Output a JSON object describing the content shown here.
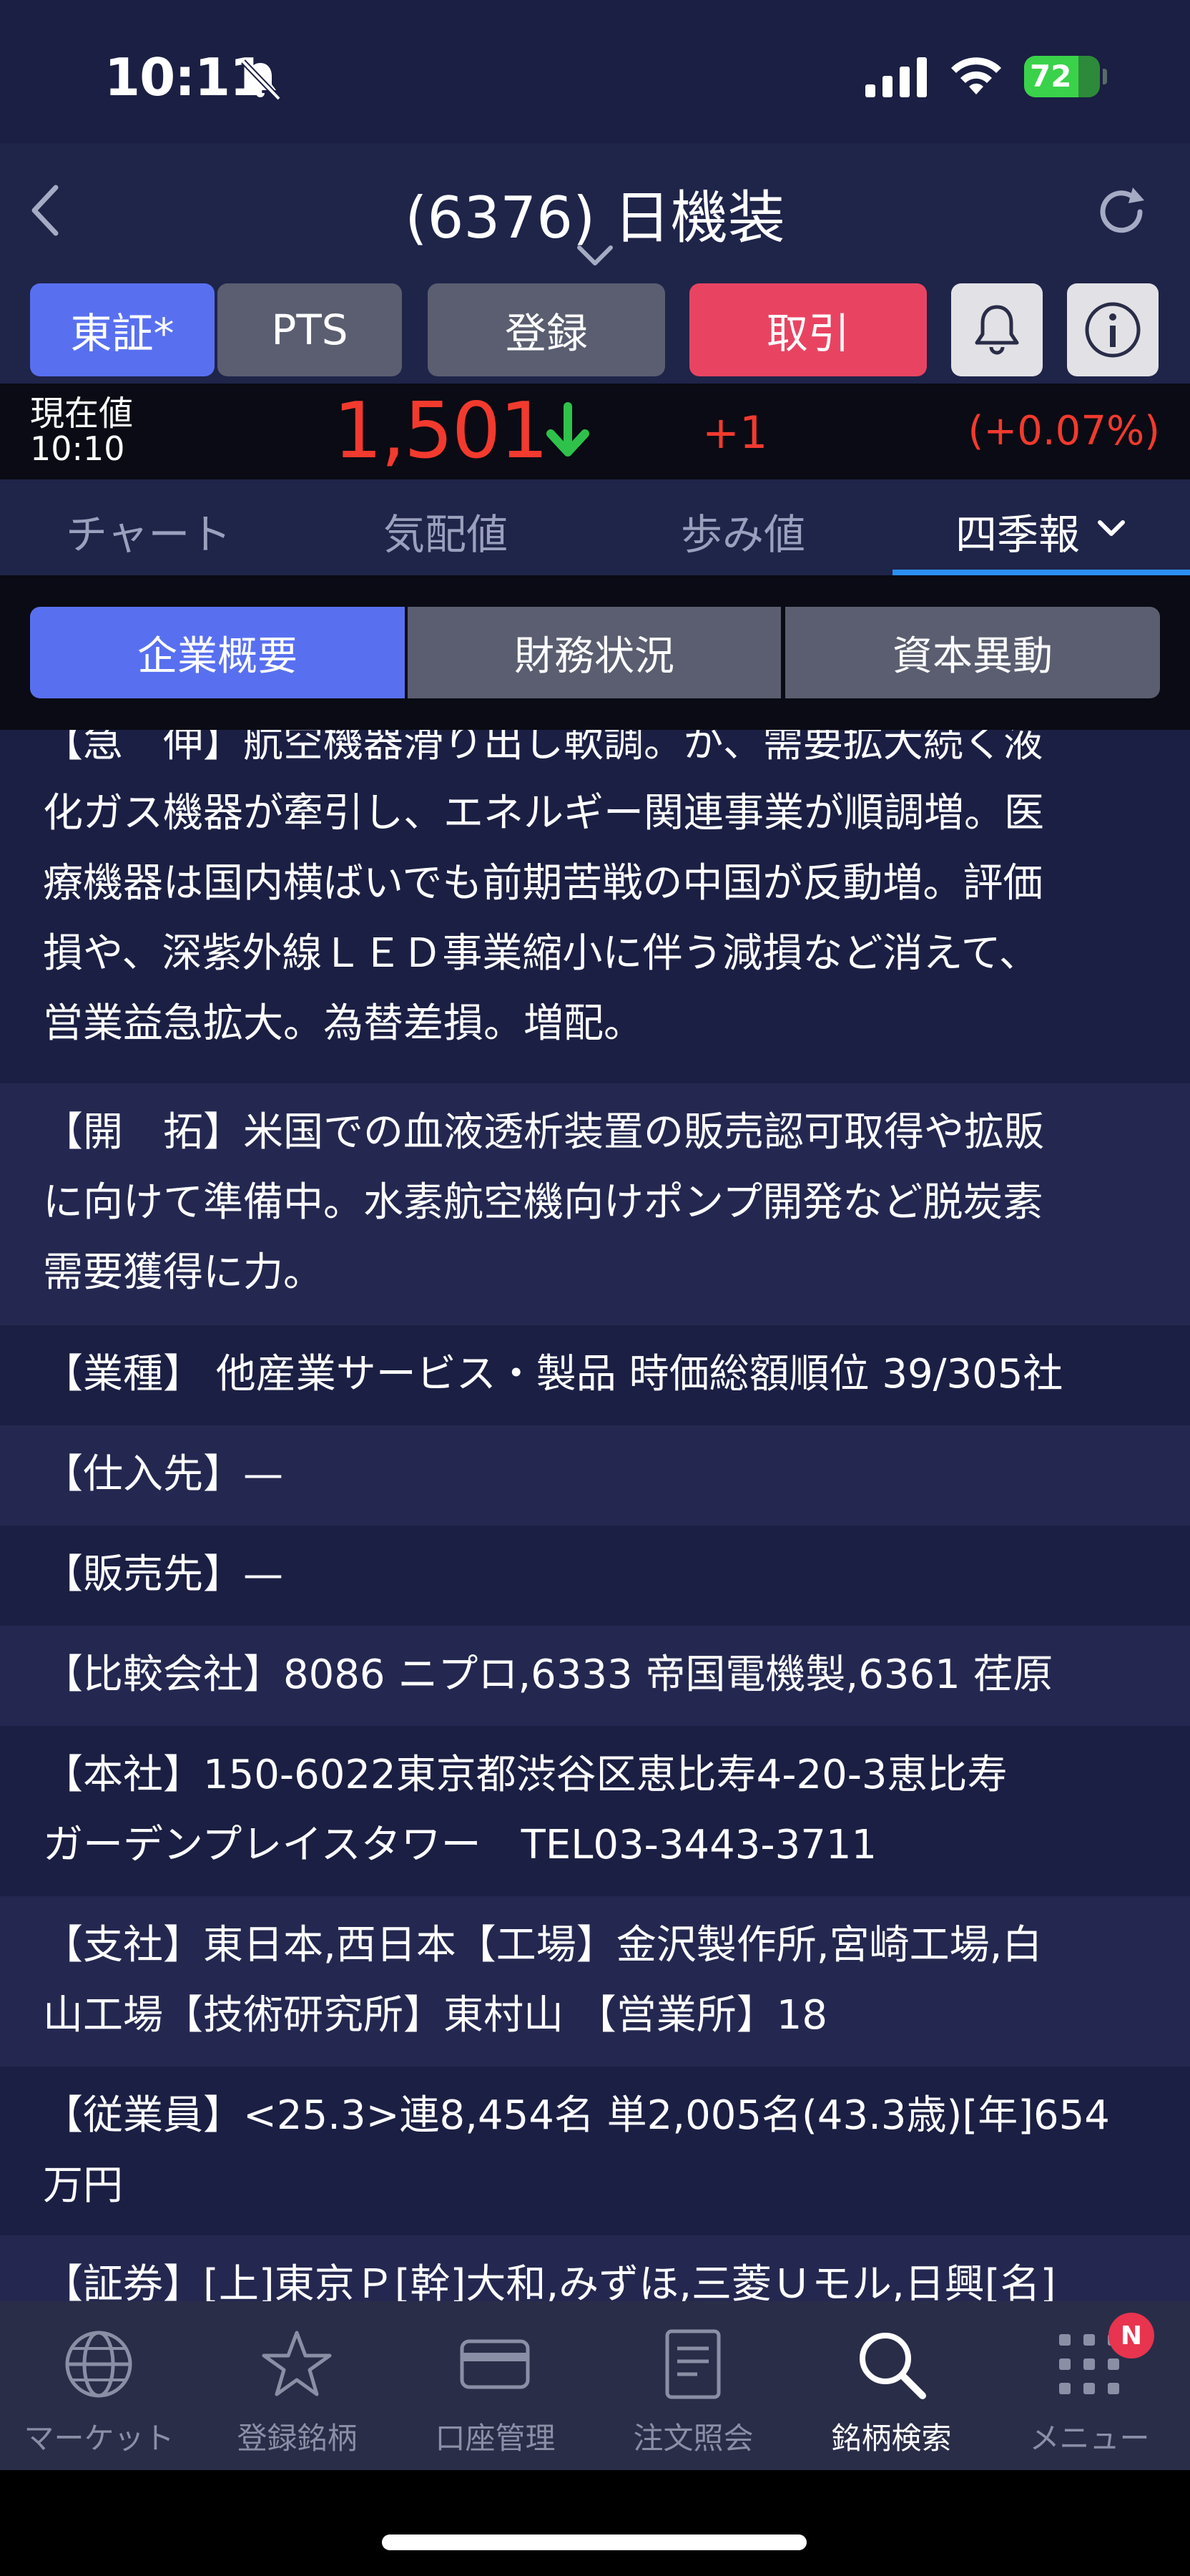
{
  "status_bar": {
    "time": "10:11",
    "battery_percent": "72",
    "battery_level": 0.72
  },
  "header": {
    "title": "(6376) 日機装"
  },
  "actions": {
    "tosho": "東証*",
    "pts": "PTS",
    "register": "登録",
    "trade": "取引"
  },
  "price": {
    "label": "現在値",
    "time": "10:10",
    "value": "1,501",
    "change": "+1",
    "change_pct": "(+0.07%)"
  },
  "tabs": [
    "チャート",
    "気配値",
    "歩み値",
    "四季報"
  ],
  "segments": [
    "企業概要",
    "財務状況",
    "資本異動"
  ],
  "content": {
    "s1_line0": "【急　伸】航空機器滑り出し軟調。が、需要拡大続く液",
    "s1_line1": "化ガス機器が牽引し、エネルギー関連事業が順調増。医",
    "s1_line2": "療機器は国内横ばいでも前期苦戦の中国が反動増。評価",
    "s1_line3": "損や、深紫外線ＬＥＤ事業縮小に伴う減損など消えて、",
    "s1_line4": "営業益急拡大。為替差損。増配。",
    "s2_line0": "【開　拓】米国での血液透析装置の販売認可取得や拡販",
    "s2_line1": "に向けて準備中。水素航空機向けポンプ開発など脱炭素",
    "s2_line2": "需要獲得に力。",
    "s3": "【業種】 他産業サービス・製品 時価総額順位 39/305社",
    "s4": "【仕入先】—",
    "s5": "【販売先】—",
    "s6": "【比較会社】8086 ニプロ,6333 帝国電機製,6361 荏原",
    "s7_line0": "【本社】150-6022東京都渋谷区恵比寿4-20-3恵比寿",
    "s7_line1": "ガーデンプレイスタワー　TEL03-3443-3711",
    "s8_line0": "【支社】東日本,西日本【工場】金沢製作所,宮崎工場,白",
    "s8_line1": "山工場【技術研究所】東村山 【営業所】18",
    "s9_line0": "【従業員】<25.3>連8,454名 単2,005名(43.3歳)[年]654",
    "s9_line1": "万円",
    "s10": "【証券】[上]東京Ｐ[幹]大和,みずほ,三菱Ｕモル,日興[名]"
  },
  "bottom_nav": {
    "market": "マーケット",
    "watchlist": "登録銘柄",
    "account": "口座管理",
    "orders": "注文照会",
    "search": "銘柄検索",
    "menu": "メニュー",
    "menu_badge": "N"
  },
  "colors": {
    "accent_blue": "#5870f0",
    "trade_red": "#e84462",
    "price_red": "#f23a2e",
    "down_green": "#2ec24a",
    "tab_underline": "#2b8ef0"
  }
}
